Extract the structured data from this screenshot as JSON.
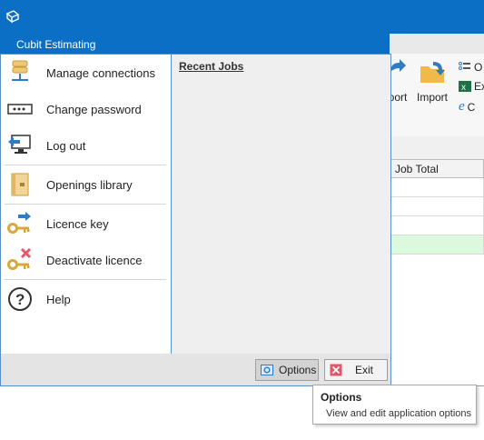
{
  "titlebar": {
    "app_name": "Cubit Estimating"
  },
  "ribbon": {
    "export_label_partial": "port",
    "import_label": "Import",
    "small_labels": [
      "O",
      "Ex",
      "C"
    ]
  },
  "grid": {
    "column_header": "Job Total"
  },
  "menu": {
    "items": [
      {
        "label": "Manage connections"
      },
      {
        "label": "Change password"
      },
      {
        "label": "Log out"
      },
      {
        "label": "Openings library"
      },
      {
        "label": "Licence key"
      },
      {
        "label": "Deactivate licence"
      },
      {
        "label": "Help"
      }
    ],
    "recent_jobs_title": "Recent Jobs",
    "options_label": "Options",
    "exit_label": "Exit"
  },
  "tooltip": {
    "title": "Options",
    "description": "View and edit application options"
  },
  "colors": {
    "titlebar": "#0a6fc5",
    "menu_border": "#5b8fc7",
    "selected_row": "#ddf9dd"
  }
}
